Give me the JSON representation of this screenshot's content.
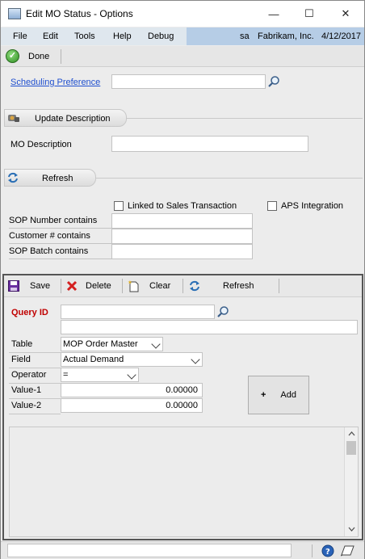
{
  "window": {
    "title": "Edit MO Status - Options",
    "minimize": "—",
    "maximize": "☐",
    "close": "✕"
  },
  "menu": {
    "items": [
      "File",
      "Edit",
      "Tools",
      "Help",
      "Debug"
    ],
    "user": "sa",
    "company": "Fabrikam, Inc.",
    "date": "4/12/2017"
  },
  "toolbar": {
    "done_label": "Done"
  },
  "form": {
    "scheduling_preference_label": "Scheduling Preference",
    "scheduling_preference_value": "",
    "update_description_label": "Update Description",
    "mo_description_label": "MO Description",
    "mo_description_value": "",
    "refresh_label": "Refresh",
    "linked_sales_label": "Linked to Sales Transaction",
    "linked_sales_checked": false,
    "aps_integration_label": "APS Integration",
    "aps_integration_checked": false,
    "sop_number_label": "SOP Number contains",
    "sop_number_value": "",
    "customer_label": "Customer # contains",
    "customer_value": "",
    "sop_batch_label": "SOP Batch contains",
    "sop_batch_value": ""
  },
  "query_toolbar": {
    "save_label": "Save",
    "delete_label": "Delete",
    "clear_label": "Clear",
    "refresh_label": "Refresh"
  },
  "query": {
    "query_id_label": "Query ID",
    "query_id_value": "",
    "query_description_value": "",
    "table_label": "Table",
    "table_value": "MOP Order Master",
    "field_label": "Field",
    "field_value": "Actual Demand",
    "operator_label": "Operator",
    "operator_value": "=",
    "value1_label": "Value-1",
    "value1": "0.00000",
    "value2_label": "Value-2",
    "value2": "0.00000",
    "add_label": "Add",
    "add_symbol": "+"
  },
  "colors": {
    "link": "#1f4fcf",
    "query_id_label": "#c00000",
    "menu_right_bg": "#b6cde6"
  },
  "icons": [
    "window-app-icon",
    "done-check-icon",
    "lookup-magnifier-icon",
    "update-description-icon",
    "refresh-icon",
    "save-disk-icon",
    "delete-x-icon",
    "clear-new-icon",
    "help-icon",
    "note-icon"
  ]
}
